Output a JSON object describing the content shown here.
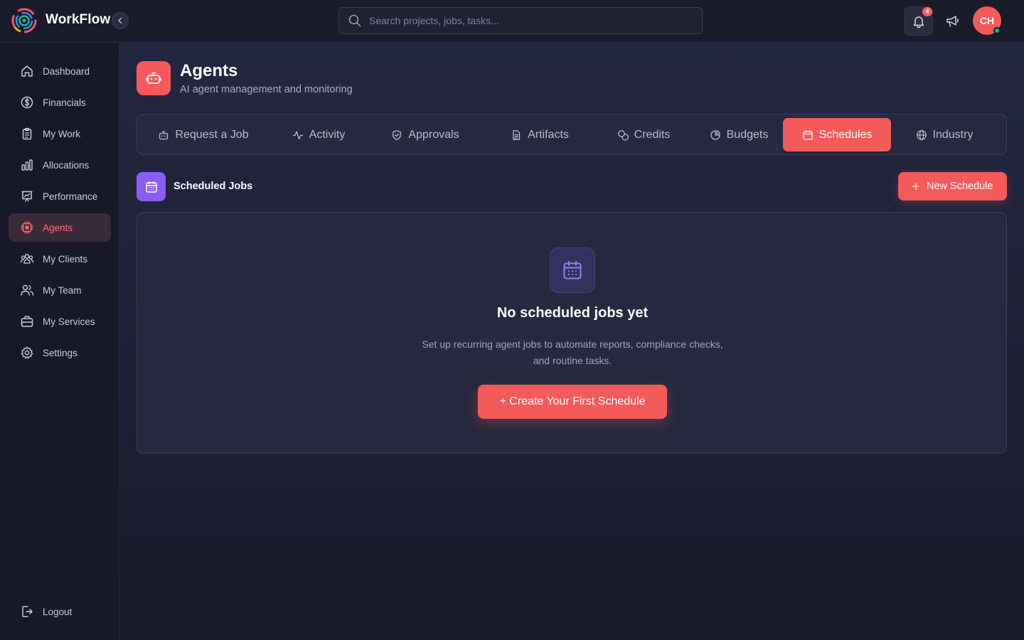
{
  "app": {
    "brand": "WorkFlow"
  },
  "header": {
    "search_placeholder": "Search projects, jobs, tasks...",
    "notification_count": "4",
    "avatar_initials": "CH"
  },
  "sidebar": {
    "items": [
      {
        "label": "Dashboard",
        "icon": "home-icon"
      },
      {
        "label": "Financials",
        "icon": "dollar-icon"
      },
      {
        "label": "My Work",
        "icon": "clipboard-icon"
      },
      {
        "label": "Allocations",
        "icon": "bar-chart-icon"
      },
      {
        "label": "Performance",
        "icon": "presentation-chart-icon"
      },
      {
        "label": "Agents",
        "icon": "cpu-chip-icon",
        "active": true
      },
      {
        "label": "My Clients",
        "icon": "users-group-icon"
      },
      {
        "label": "My Team",
        "icon": "users-icon"
      },
      {
        "label": "My Services",
        "icon": "briefcase-icon"
      },
      {
        "label": "Settings",
        "icon": "gear-icon"
      }
    ],
    "logout_label": "Logout"
  },
  "page": {
    "title": "Agents",
    "subtitle": "AI agent management and monitoring"
  },
  "tabs": [
    {
      "label": "Request a Job",
      "icon": "robot-icon"
    },
    {
      "label": "Activity",
      "icon": "activity-icon"
    },
    {
      "label": "Approvals",
      "icon": "shield-check-icon"
    },
    {
      "label": "Artifacts",
      "icon": "document-icon"
    },
    {
      "label": "Credits",
      "icon": "coins-icon"
    },
    {
      "label": "Budgets",
      "icon": "pie-chart-icon"
    },
    {
      "label": "Schedules",
      "icon": "calendar-icon",
      "active": true
    },
    {
      "label": "Industry",
      "icon": "globe-icon"
    }
  ],
  "section": {
    "title": "Scheduled Jobs",
    "new_button_label": "New Schedule"
  },
  "empty_state": {
    "title": "No scheduled jobs yet",
    "description": "Set up recurring agent jobs to automate reports, compliance checks, and routine tasks.",
    "button_label": "+ Create Your First Schedule"
  },
  "colors": {
    "accent": "#f45a5a",
    "background": "#1c1e30",
    "sidebar_background": "#181928",
    "section_icon": "#8b5cf6",
    "online": "#1fb29a"
  }
}
